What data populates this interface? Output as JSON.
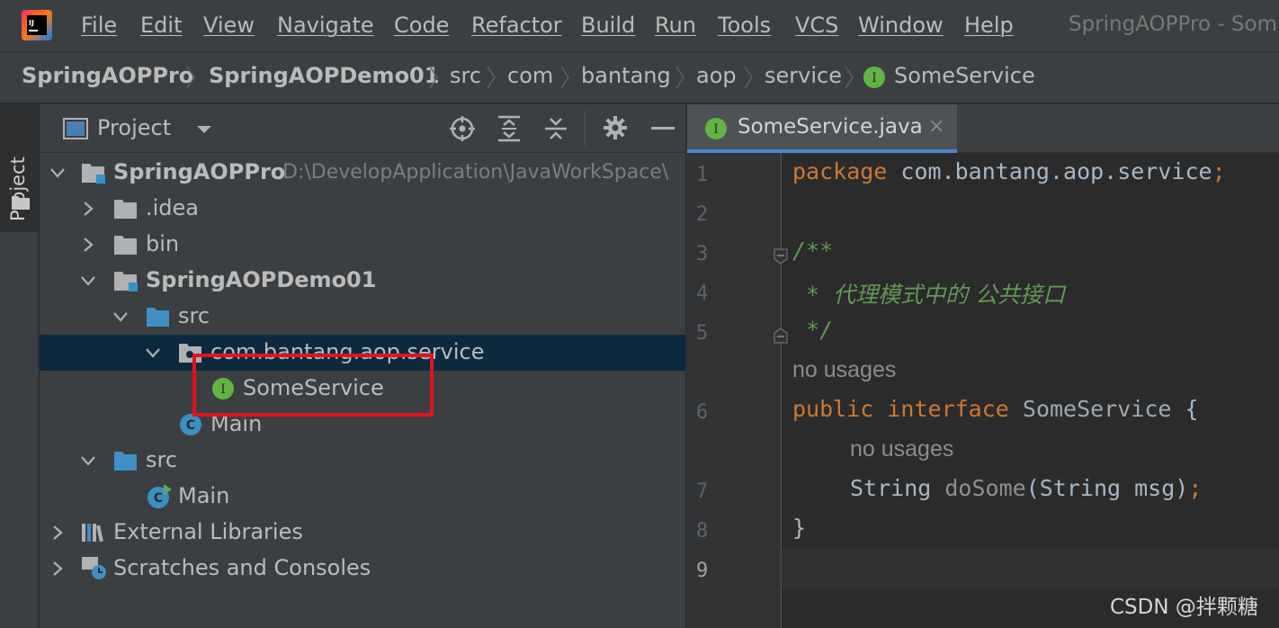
{
  "app": {
    "logo_icon": "intellij-logo-icon",
    "window_title": "SpringAOPPro - Som"
  },
  "menu": [
    "File",
    "Edit",
    "View",
    "Navigate",
    "Code",
    "Refactor",
    "Build",
    "Run",
    "Tools",
    "VCS",
    "Window",
    "Help"
  ],
  "breadcrumb": {
    "items": [
      "SpringAOPPro",
      "SpringAOPDemo01",
      "src",
      "com",
      "bantang",
      "aop",
      "service",
      "SomeService"
    ],
    "last_icon": "interface-icon"
  },
  "toolstrip": {
    "project_label": "Project"
  },
  "project_panel": {
    "title": "Project",
    "toolbar_icons": [
      "locate-icon",
      "expand-all-icon",
      "collapse-all-icon",
      "settings-gear-icon",
      "hide-icon"
    ],
    "tree": [
      {
        "label": "SpringAOPPro",
        "path": "D:\\DevelopApplication\\JavaWorkSpace\\",
        "icon": "module-folder-icon",
        "expanded": true,
        "bold": true
      },
      {
        "label": ".idea",
        "icon": "folder-icon",
        "expanded": false
      },
      {
        "label": "bin",
        "icon": "folder-icon",
        "expanded": false
      },
      {
        "label": "SpringAOPDemo01",
        "icon": "module-folder-icon",
        "expanded": true,
        "bold": true
      },
      {
        "label": "src",
        "icon": "source-folder-icon",
        "expanded": true
      },
      {
        "label": "com.bantang.aop.service",
        "icon": "package-icon",
        "expanded": true,
        "selected": true
      },
      {
        "label": "SomeService",
        "icon": "interface-icon"
      },
      {
        "label": "Main",
        "icon": "class-icon"
      },
      {
        "label": "src",
        "icon": "source-folder-icon",
        "expanded": true
      },
      {
        "label": "Main",
        "icon": "runnable-class-icon"
      },
      {
        "label": "External Libraries",
        "icon": "libraries-icon",
        "expanded": false
      },
      {
        "label": "Scratches and Consoles",
        "icon": "scratches-icon",
        "expanded": false
      }
    ]
  },
  "editor": {
    "tab_label": "SomeService.java",
    "tab_close": "×",
    "line_numbers": [
      "1",
      "2",
      "3",
      "4",
      "5",
      "6",
      "7",
      "8",
      "9"
    ],
    "usage_hint": "no usages",
    "code": {
      "l1_kw": "package",
      "l1_rest": " com.bantang.aop.service",
      "l1_semi": ";",
      "l3": "/**",
      "l4_star": " * ",
      "l4_text": "代理模式中的 公共接口",
      "l5": " */",
      "l6_kw1": "public",
      "l6_kw2": "interface",
      "l6_name": "SomeService",
      "l6_brace": " {",
      "l7_type": "String",
      "l7_fn": "doSome",
      "l7_args": "(String msg)",
      "l7_semi": ";",
      "l8": "}"
    }
  },
  "watermark": "CSDN @拌颗糖",
  "colors": {
    "background": "#2b2b2b",
    "panel": "#3c3f41",
    "selection": "#0d293e",
    "keyword": "#cc7832",
    "comment": "#629755",
    "highlight_box": "#e0141e",
    "interface_icon": "#62b543"
  }
}
